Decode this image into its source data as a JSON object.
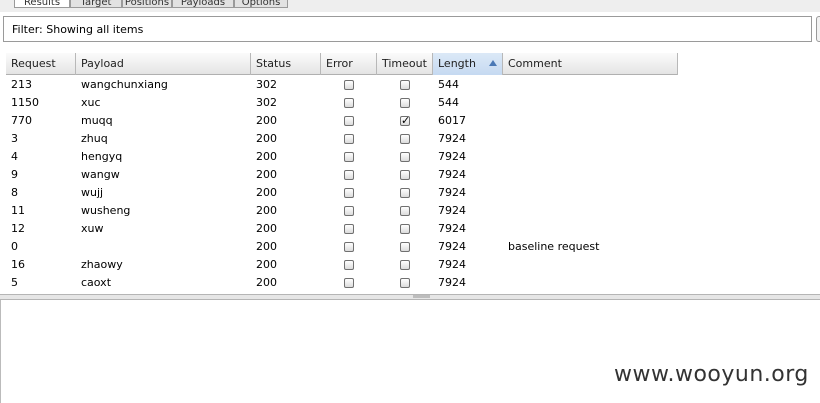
{
  "tabs": [
    {
      "label": "Results",
      "active": true
    },
    {
      "label": "Target",
      "active": false
    },
    {
      "label": "Positions",
      "active": false
    },
    {
      "label": "Payloads",
      "active": false
    },
    {
      "label": "Options",
      "active": false
    }
  ],
  "filter": {
    "text": "Filter: Showing all items"
  },
  "table": {
    "columns": [
      "Request",
      "Payload",
      "Status",
      "Error",
      "Timeout",
      "Length",
      "Comment"
    ],
    "sorted_column": "Length",
    "rows": [
      {
        "request": "213",
        "payload": "wangchunxiang",
        "status": "302",
        "error": false,
        "timeout": false,
        "length": "544",
        "comment": ""
      },
      {
        "request": "1150",
        "payload": "xuc",
        "status": "302",
        "error": false,
        "timeout": false,
        "length": "544",
        "comment": ""
      },
      {
        "request": "770",
        "payload": "muqq",
        "status": "200",
        "error": false,
        "timeout": true,
        "length": "6017",
        "comment": ""
      },
      {
        "request": "3",
        "payload": "zhuq",
        "status": "200",
        "error": false,
        "timeout": false,
        "length": "7924",
        "comment": ""
      },
      {
        "request": "4",
        "payload": "hengyq",
        "status": "200",
        "error": false,
        "timeout": false,
        "length": "7924",
        "comment": ""
      },
      {
        "request": "9",
        "payload": "wangw",
        "status": "200",
        "error": false,
        "timeout": false,
        "length": "7924",
        "comment": ""
      },
      {
        "request": "8",
        "payload": "wujj",
        "status": "200",
        "error": false,
        "timeout": false,
        "length": "7924",
        "comment": ""
      },
      {
        "request": "11",
        "payload": "wusheng",
        "status": "200",
        "error": false,
        "timeout": false,
        "length": "7924",
        "comment": ""
      },
      {
        "request": "12",
        "payload": "xuw",
        "status": "200",
        "error": false,
        "timeout": false,
        "length": "7924",
        "comment": ""
      },
      {
        "request": "0",
        "payload": "",
        "status": "200",
        "error": false,
        "timeout": false,
        "length": "7924",
        "comment": "baseline request"
      },
      {
        "request": "16",
        "payload": "zhaowy",
        "status": "200",
        "error": false,
        "timeout": false,
        "length": "7924",
        "comment": ""
      },
      {
        "request": "5",
        "payload": "caoxt",
        "status": "200",
        "error": false,
        "timeout": false,
        "length": "7924",
        "comment": ""
      }
    ]
  },
  "watermark": "www.wooyun.org"
}
